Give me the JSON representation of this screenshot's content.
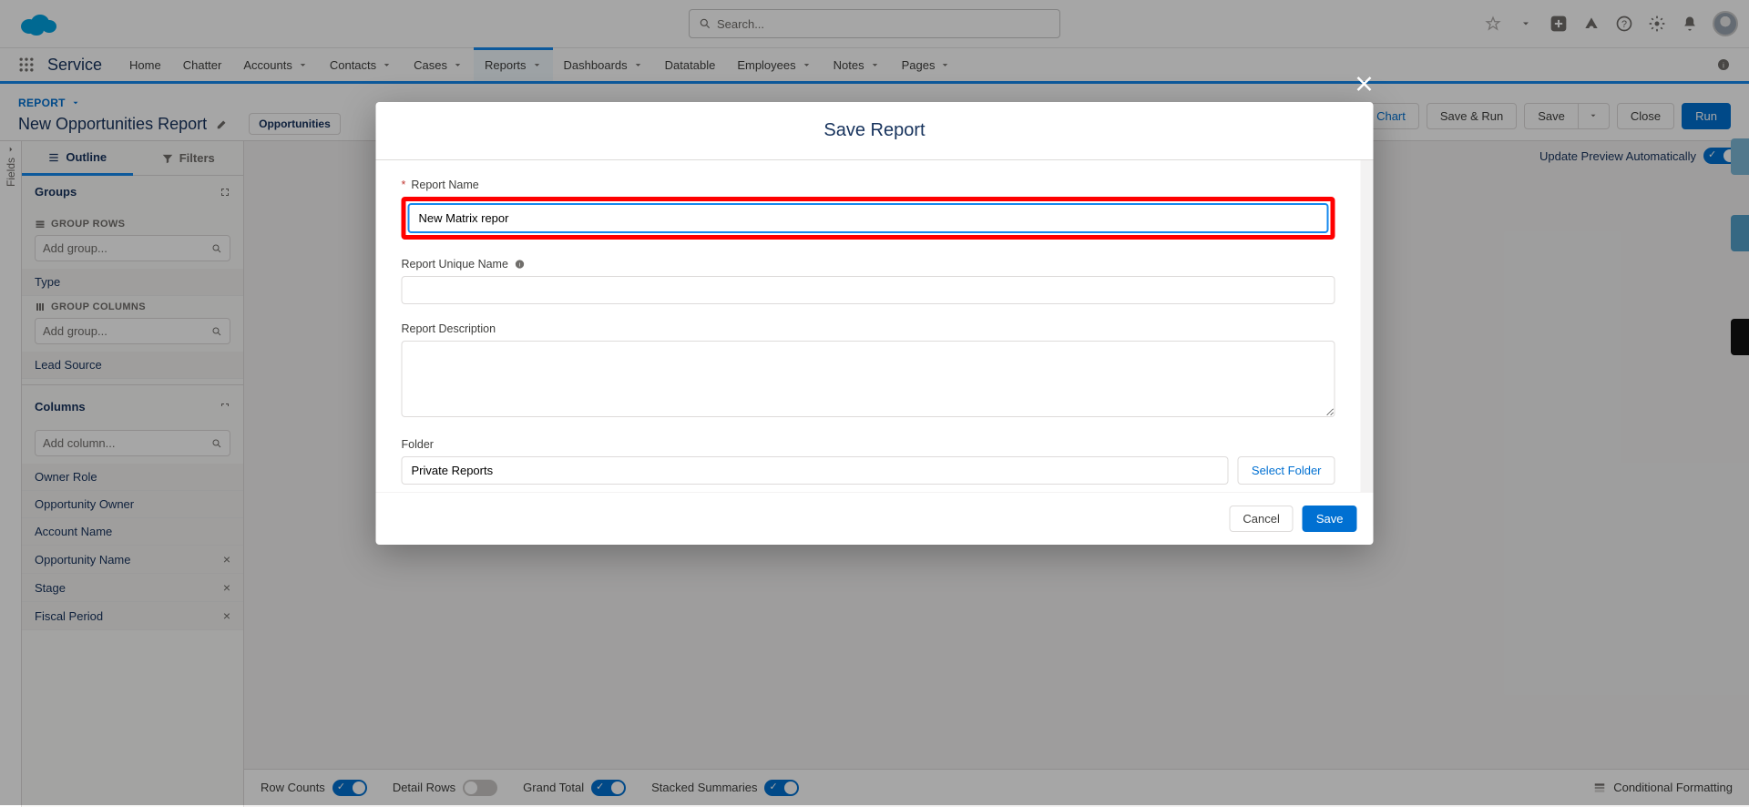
{
  "search": {
    "placeholder": "Search..."
  },
  "appName": "Service",
  "nav": {
    "items": [
      {
        "label": "Home"
      },
      {
        "label": "Chatter"
      },
      {
        "label": "Accounts",
        "menu": true
      },
      {
        "label": "Contacts",
        "menu": true
      },
      {
        "label": "Cases",
        "menu": true
      },
      {
        "label": "Reports",
        "menu": true,
        "active": true
      },
      {
        "label": "Dashboards",
        "menu": true
      },
      {
        "label": "Datatable"
      },
      {
        "label": "Employees",
        "menu": true
      },
      {
        "label": "Notes",
        "menu": true
      },
      {
        "label": "Pages",
        "menu": true
      }
    ]
  },
  "reportHead": {
    "crumb": "REPORT",
    "title": "New Opportunities Report",
    "pill": "Opportunities"
  },
  "actions": {
    "addChart": "Add Chart",
    "saveRun": "Save & Run",
    "save": "Save",
    "close": "Close",
    "run": "Run"
  },
  "updatePreview": "Update Preview Automatically",
  "panel": {
    "tabs": {
      "outline": "Outline",
      "filters": "Filters"
    },
    "groups": "Groups",
    "groupRows": "GROUP ROWS",
    "groupCols": "GROUP COLUMNS",
    "addGroup": "Add group...",
    "rowChips": [
      "Type"
    ],
    "colChips": [
      "Lead Source"
    ],
    "columns": "Columns",
    "addColumn": "Add column...",
    "columnList": [
      "Owner Role",
      "Opportunity Owner",
      "Account Name",
      "Opportunity Name",
      "Stage",
      "Fiscal Period"
    ]
  },
  "footer": {
    "rowCounts": "Row Counts",
    "detailRows": "Detail Rows",
    "grandTotal": "Grand Total",
    "stacked": "Stacked Summaries",
    "conditional": "Conditional Formatting"
  },
  "fieldsTab": "Fields",
  "modal": {
    "title": "Save Report",
    "reportNameLabel": "Report Name",
    "reportNameValue": "New Matrix repor",
    "uniqueLabel": "Report Unique Name",
    "uniqueValue": "",
    "descLabel": "Report Description",
    "descValue": "",
    "folderLabel": "Folder",
    "folderValue": "Private Reports",
    "selectFolder": "Select Folder",
    "cancel": "Cancel",
    "save": "Save"
  }
}
